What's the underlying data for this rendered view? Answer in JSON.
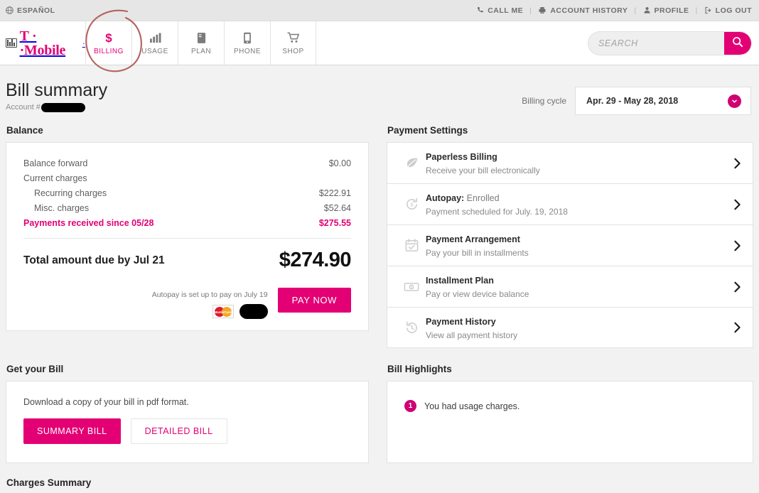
{
  "utility": {
    "espanol": "ESPAÑOL",
    "links": [
      {
        "label": "CALL ME",
        "icon": "phone-icon"
      },
      {
        "label": "ACCOUNT HISTORY",
        "icon": "printer-icon"
      },
      {
        "label": "PROFILE",
        "icon": "person-icon"
      },
      {
        "label": "LOG OUT",
        "icon": "logout-icon"
      }
    ],
    "separator": "|"
  },
  "brand": {
    "wordmark": "T · ·Mobile",
    "tail": "·"
  },
  "nav": {
    "items": [
      {
        "label": "BILLING",
        "icon": "dollar-icon",
        "active": true
      },
      {
        "label": "USAGE",
        "icon": "bar-chart-icon",
        "active": false
      },
      {
        "label": "PLAN",
        "icon": "document-icon",
        "active": false
      },
      {
        "label": "PHONE",
        "icon": "phone-device-icon",
        "active": false
      },
      {
        "label": "SHOP",
        "icon": "shopping-cart-icon",
        "active": false
      }
    ]
  },
  "search": {
    "placeholder": "SEARCH",
    "value": "",
    "icon": "search-icon"
  },
  "page": {
    "title": "Bill summary",
    "account_label": "Account #",
    "account_value": "",
    "billing_cycle_label": "Billing cycle",
    "billing_cycle_value": "Apr. 29 - May 28, 2018"
  },
  "balance": {
    "section_title": "Balance",
    "rows": [
      {
        "name": "Balance forward",
        "amount": "$0.00",
        "indent": false,
        "highlight": false
      },
      {
        "name": "Current charges",
        "amount": "",
        "indent": false,
        "highlight": false
      },
      {
        "name": "Recurring charges",
        "amount": "$222.91",
        "indent": true,
        "highlight": false
      },
      {
        "name": "Misc. charges",
        "amount": "$52.64",
        "indent": true,
        "highlight": false
      },
      {
        "name": "Payments received since 05/28",
        "amount": "$275.55",
        "indent": false,
        "highlight": true
      }
    ],
    "total_label": "Total amount due by Jul 21",
    "total_amount": "$274.90",
    "autopay_note": "Autopay is set up to pay on July 19",
    "mastercard_label": "MasterCard",
    "pay_now_label": "PAY NOW"
  },
  "payment_settings": {
    "section_title": "Payment Settings",
    "rows": [
      {
        "title": "Paperless Billing",
        "title_suffix": "",
        "subtitle": "Receive your bill electronically",
        "icon": "leaf-icon"
      },
      {
        "title": "Autopay:",
        "title_suffix": "Enrolled",
        "subtitle": "Payment scheduled for July. 19, 2018",
        "icon": "autopay-refresh-icon"
      },
      {
        "title": "Payment Arrangement",
        "title_suffix": "",
        "subtitle": "Pay your bill in installments",
        "icon": "calendar-check-icon"
      },
      {
        "title": "Installment Plan",
        "title_suffix": "",
        "subtitle": "Pay or view device balance",
        "icon": "banknote-icon"
      },
      {
        "title": "Payment History",
        "title_suffix": "",
        "subtitle": "View all payment history",
        "icon": "clock-history-icon"
      }
    ]
  },
  "get_bill": {
    "section_title": "Get your Bill",
    "description": "Download a copy of your bill in pdf format.",
    "summary_label": "SUMMARY BILL",
    "detailed_label": "DETAILED BILL"
  },
  "bill_highlights": {
    "section_title": "Bill Highlights",
    "items": [
      {
        "badge": "1",
        "text": "You had usage charges."
      }
    ]
  },
  "charges_summary": {
    "section_title": "Charges Summary"
  },
  "colors": {
    "magenta": "#e20074",
    "magenta_dark": "#cf0072",
    "page_bg": "#f2f2f2",
    "annotation": "#b5625f"
  }
}
